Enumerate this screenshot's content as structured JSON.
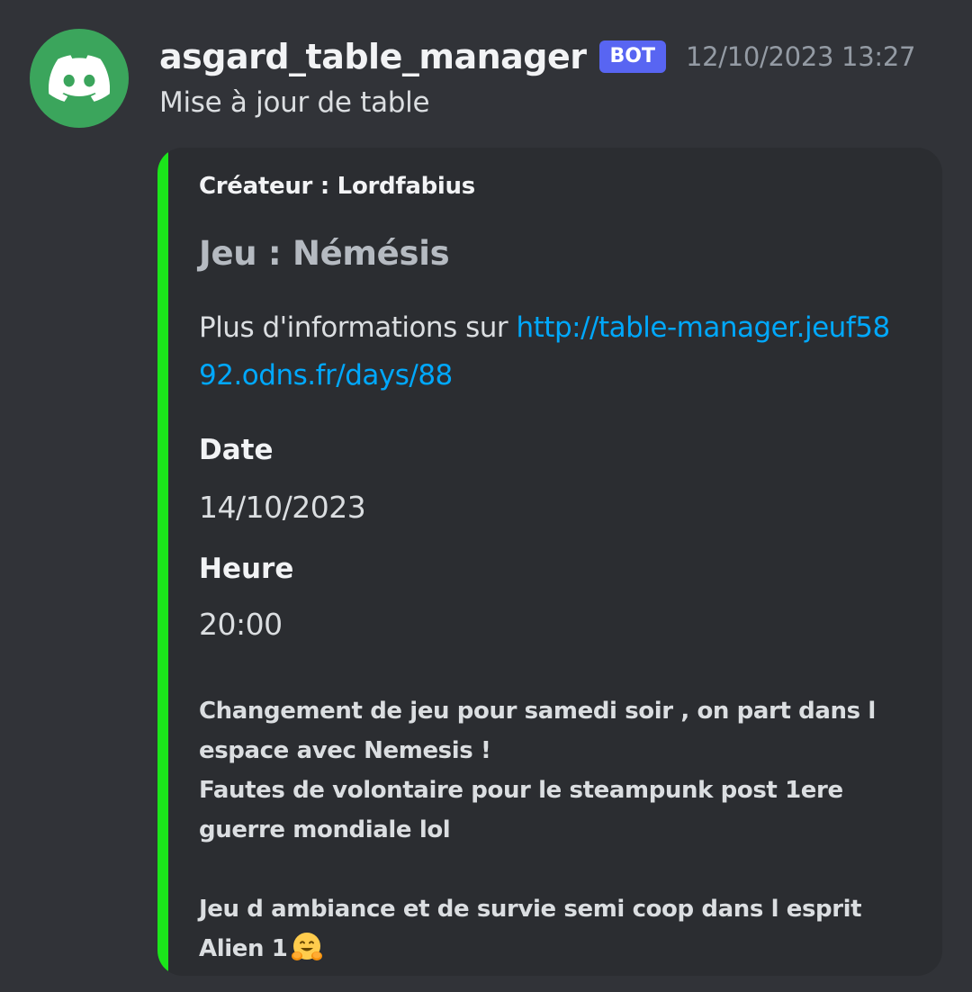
{
  "message": {
    "avatar_icon": "discord-logo-icon",
    "avatar_color": "#3ba55c",
    "username": "asgard_table_manager",
    "badge": "BOT",
    "badge_color": "#5865f2",
    "timestamp": "12/10/2023 13:27",
    "text": "Mise à jour de table"
  },
  "embed": {
    "accent_color": "#1be51b",
    "author": "Créateur : Lordfabius",
    "title": "Jeu : Némésis",
    "description_prefix": "Plus d'informations sur ",
    "link": "http://table-manager.jeuf5892.odns.fr/days/88",
    "link_color": "#00a8fc",
    "fields": [
      {
        "name": "Date",
        "value": "14/10/2023"
      },
      {
        "name": "Heure",
        "value": "20:00"
      }
    ],
    "footer_text": "Changement de jeu pour samedi soir , on part dans l espace avec Nemesis !\nFautes de volontaire pour le steampunk post 1ere guerre mondiale lol\n\nJeu d ambiance et de survie semi coop dans l esprit Alien 1",
    "footer_emoji": "hugging-face-emoji-icon"
  }
}
